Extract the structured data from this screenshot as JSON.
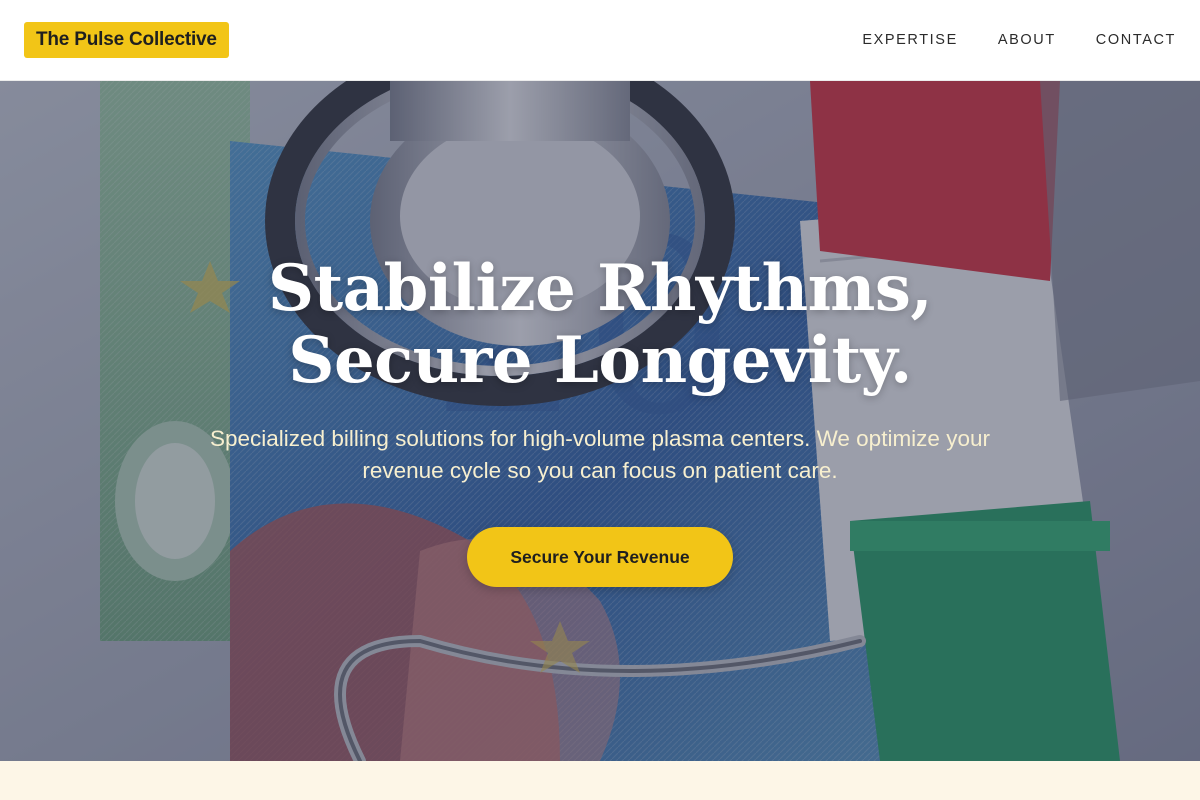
{
  "header": {
    "logo_text": "The Pulse Collective",
    "nav": [
      {
        "label": "EXPERTISE"
      },
      {
        "label": "ABOUT"
      },
      {
        "label": "CONTACT"
      }
    ]
  },
  "hero": {
    "title_line1": "Stabilize Rhythms,",
    "title_line2": "Secure Longevity.",
    "subtitle": "Specialized billing solutions for high-volume plasma centers. We optimize your revenue cycle so you can focus on patient care.",
    "cta_label": "Secure Your Revenue"
  },
  "colors": {
    "accent": "#f2c517",
    "hero_text": "#ffffff",
    "subtitle_text": "#f7efcf",
    "section_bg": "#fdf6e7"
  }
}
